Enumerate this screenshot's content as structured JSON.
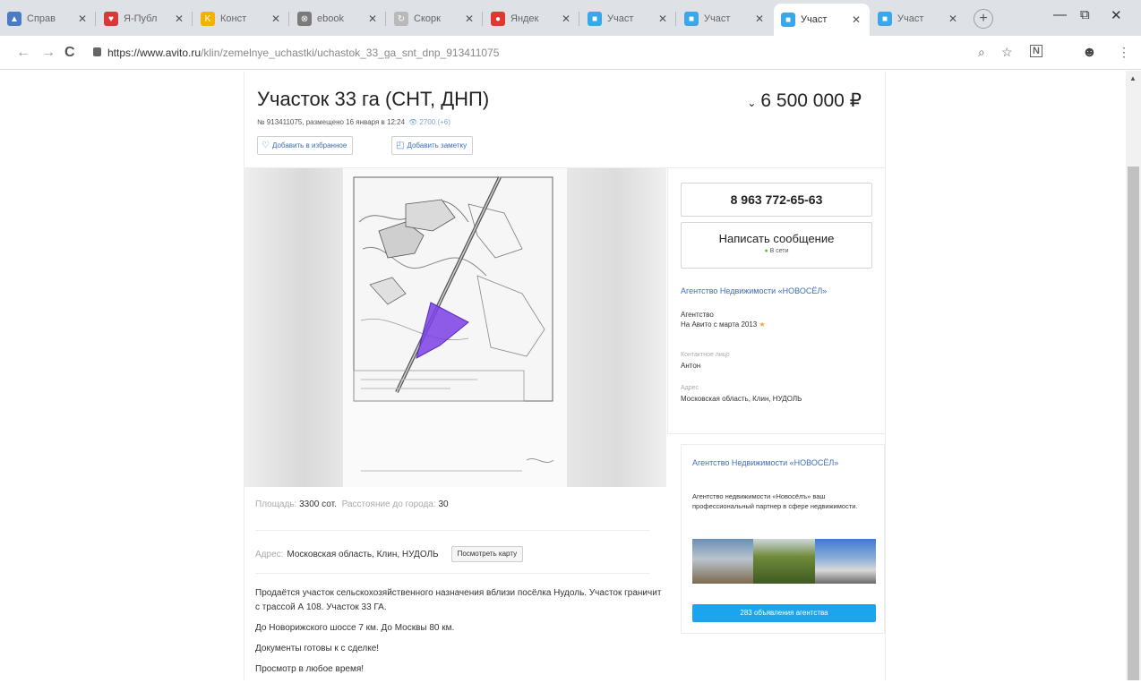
{
  "browser": {
    "tabs": [
      {
        "label": "Справ",
        "favicon_color": "#4a7bc4",
        "favicon_glyph": "▲"
      },
      {
        "label": "Я-Публ",
        "favicon_color": "#d93838",
        "favicon_glyph": "♥"
      },
      {
        "label": "Конст",
        "favicon_color": "#f0b400",
        "favicon_glyph": "K"
      },
      {
        "label": "ebook",
        "favicon_color": "#7a7a7a",
        "favicon_glyph": "⊗"
      },
      {
        "label": "Скорк",
        "favicon_color": "#b9b9b9",
        "favicon_glyph": "↻"
      },
      {
        "label": "Яндек",
        "favicon_color": "#e0382e",
        "favicon_glyph": "●"
      },
      {
        "label": "Участ",
        "favicon_color": "#3ba6e8",
        "favicon_glyph": "■"
      },
      {
        "label": "Участ",
        "favicon_color": "#3ba6e8",
        "favicon_glyph": "■"
      },
      {
        "label": "Участ",
        "favicon_color": "#3ba6e8",
        "favicon_glyph": "■",
        "active": true
      },
      {
        "label": "Участ",
        "favicon_color": "#3ba6e8",
        "favicon_glyph": "■"
      }
    ],
    "new_tab": "+",
    "window_controls": {
      "minimize": "—",
      "maximize": "⧉",
      "close": "✕"
    },
    "nav": {
      "back": "←",
      "forward": "→",
      "reload": "C"
    },
    "url_host": "https://www.avito.ru",
    "url_path": "/klin/zemelnye_uchastki/uchastok_33_ga_snt_dnp_913411075",
    "toolbar_icons": {
      "zoom": "⌕",
      "bookmark": "☆",
      "extension": "N",
      "profile": "☻",
      "menu": "⋮"
    }
  },
  "listing": {
    "title": "Участок 33 га (СНТ, ДНП)",
    "meta": "№ 913411075, размещено 16 января в 12:24",
    "views": "2700 (+6)",
    "price": "6 500 000 ₽",
    "price_caret": "⌄",
    "favorite_btn": "Добавить в избранное",
    "note_btn": "Добавить заметку",
    "params": [
      {
        "label": "Площадь:",
        "value": "3300 сот."
      },
      {
        "label": "Расстояние до города:",
        "value": "30"
      }
    ],
    "address_label": "Адрес:",
    "address_value": "Московская область, Клин, НУДОЛЬ",
    "map_btn": "Посмотреть карту",
    "description": [
      "Продаётся участок сельскохозяйственного назначения вблизи посёлка Нудоль. Участок граничит с трассой А 108. Участок 33 ГА.",
      "До Новорижского шоссе 7 км. До Москвы 80 км.",
      "Документы готовы к с сделке!",
      "Просмотр в любое время!"
    ]
  },
  "seller": {
    "phone": "8 963 772-65-63",
    "message_btn": "Написать сообщение",
    "online_status": "В сети",
    "online_dot": "●",
    "name": "Агентство Недвижимости «НОВОСЁЛ»",
    "type": "Агентство",
    "since": "На Авито с марта 2013",
    "star": "★",
    "contact_label": "Контактное лицо",
    "contact_name": "Антон",
    "address_label": "Адрес",
    "address": "Московская область, Клин, НУДОЛЬ"
  },
  "agency": {
    "name": "Агентство Недвижимости «НОВОСЁЛ»",
    "description": "Агентство недвижимости «Новосёлъ» ваш профессиональный партнер в сфере недвижимости.",
    "ads_button": "283 объявления агентства"
  },
  "colors": {
    "link": "#3e6db6",
    "accent_button": "#1aa5ee",
    "plot_highlight": "#7b3fe6"
  }
}
